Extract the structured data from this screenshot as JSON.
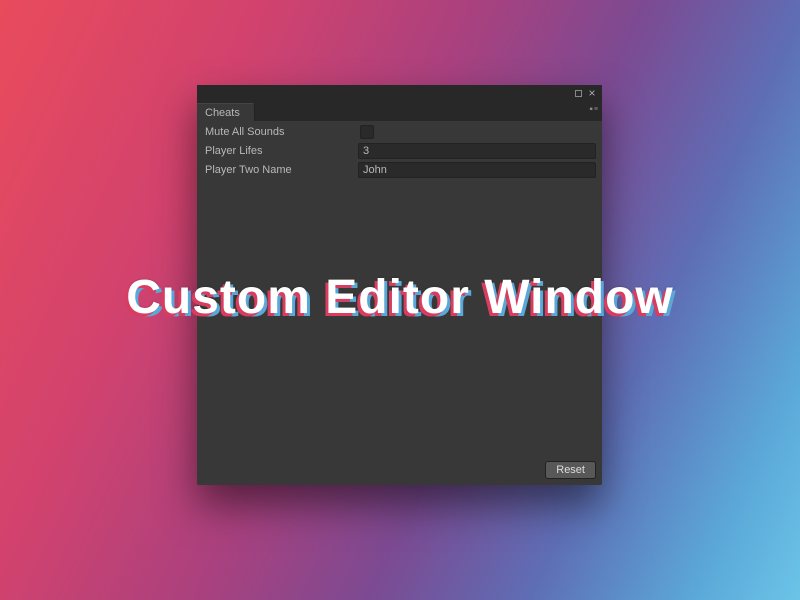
{
  "tab": {
    "label": "Cheats"
  },
  "properties": {
    "muteAllSounds": {
      "label": "Mute All Sounds",
      "checked": false
    },
    "playerLifes": {
      "label": "Player Lifes",
      "value": "3"
    },
    "playerTwoName": {
      "label": "Player Two Name",
      "value": "John"
    }
  },
  "buttons": {
    "reset": "Reset"
  },
  "overlay": {
    "title": "Custom Editor Window"
  }
}
